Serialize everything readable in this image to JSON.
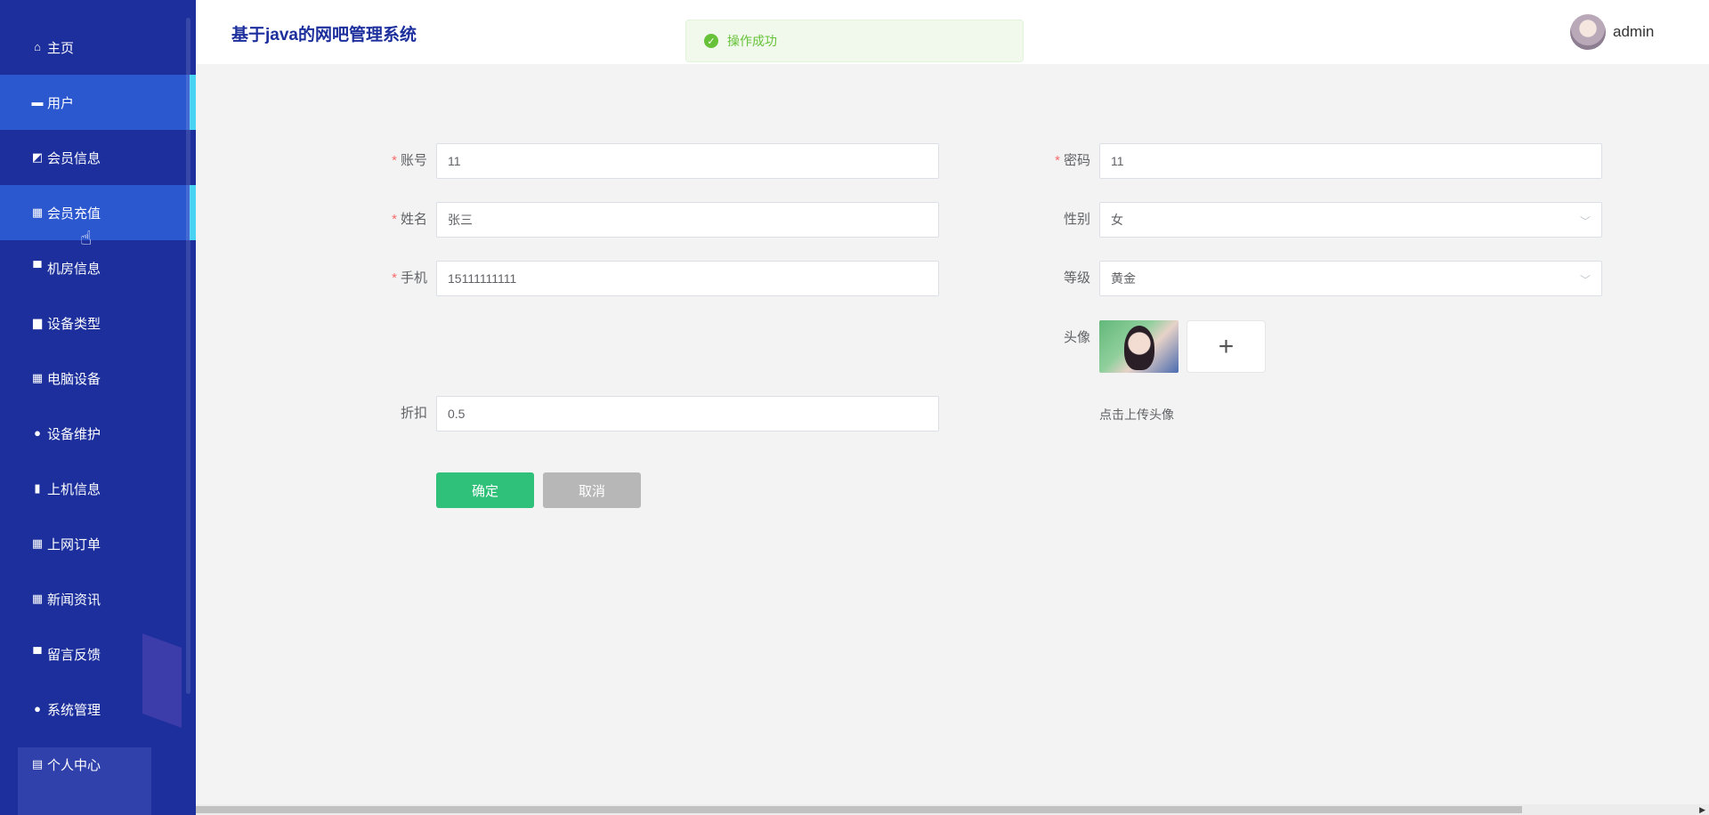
{
  "app": {
    "title": "基于java的网吧管理系统",
    "username": "admin"
  },
  "toast": {
    "message": "操作成功"
  },
  "sidebar": {
    "items": [
      {
        "label": "主页",
        "icon": "home-icon",
        "glyph": "⌂",
        "active": false
      },
      {
        "label": "用户",
        "icon": "ticket-icon",
        "glyph": "▬",
        "active": true
      },
      {
        "label": "会员信息",
        "icon": "chart-icon",
        "glyph": "◩",
        "active": false
      },
      {
        "label": "会员充值",
        "icon": "grid-icon",
        "glyph": "▦",
        "active": true
      },
      {
        "label": "机房信息",
        "icon": "monitor-icon",
        "glyph": "▀",
        "active": false
      },
      {
        "label": "设备类型",
        "icon": "briefcase-icon",
        "glyph": "▆",
        "active": false
      },
      {
        "label": "电脑设备",
        "icon": "grid-icon",
        "glyph": "▦",
        "active": false
      },
      {
        "label": "设备维护",
        "icon": "user-icon",
        "glyph": "●",
        "active": false
      },
      {
        "label": "上机信息",
        "icon": "clipboard-icon",
        "glyph": "▮",
        "active": false
      },
      {
        "label": "上网订单",
        "icon": "grid-icon",
        "glyph": "▦",
        "active": false
      },
      {
        "label": "新闻资讯",
        "icon": "grid-icon",
        "glyph": "▦",
        "active": false
      },
      {
        "label": "留言反馈",
        "icon": "monitor-icon",
        "glyph": "▀",
        "active": false
      },
      {
        "label": "系统管理",
        "icon": "user-icon",
        "glyph": "●",
        "active": false
      },
      {
        "label": "个人中心",
        "icon": "calendar-icon",
        "glyph": "▤",
        "active": false
      }
    ]
  },
  "form": {
    "account": {
      "label": "账号",
      "value": "11",
      "required": true
    },
    "password": {
      "label": "密码",
      "value": "11",
      "required": true
    },
    "name": {
      "label": "姓名",
      "value": "张三",
      "required": true
    },
    "gender": {
      "label": "性别",
      "value": "女"
    },
    "phone": {
      "label": "手机",
      "value": "15111111111",
      "required": true
    },
    "level": {
      "label": "等级",
      "value": "黄金"
    },
    "avatar": {
      "label": "头像",
      "hint": "点击上传头像",
      "add": "+"
    },
    "discount": {
      "label": "折扣",
      "value": "0.5"
    },
    "confirm": "确定",
    "cancel": "取消"
  },
  "colors": {
    "sidebar": "#1c2f9c",
    "active": "#2b57cf",
    "active_bar": "#48d3f5",
    "confirm": "#2fc07a",
    "cancel": "#b7b7b7",
    "required": "#f56c6c"
  }
}
